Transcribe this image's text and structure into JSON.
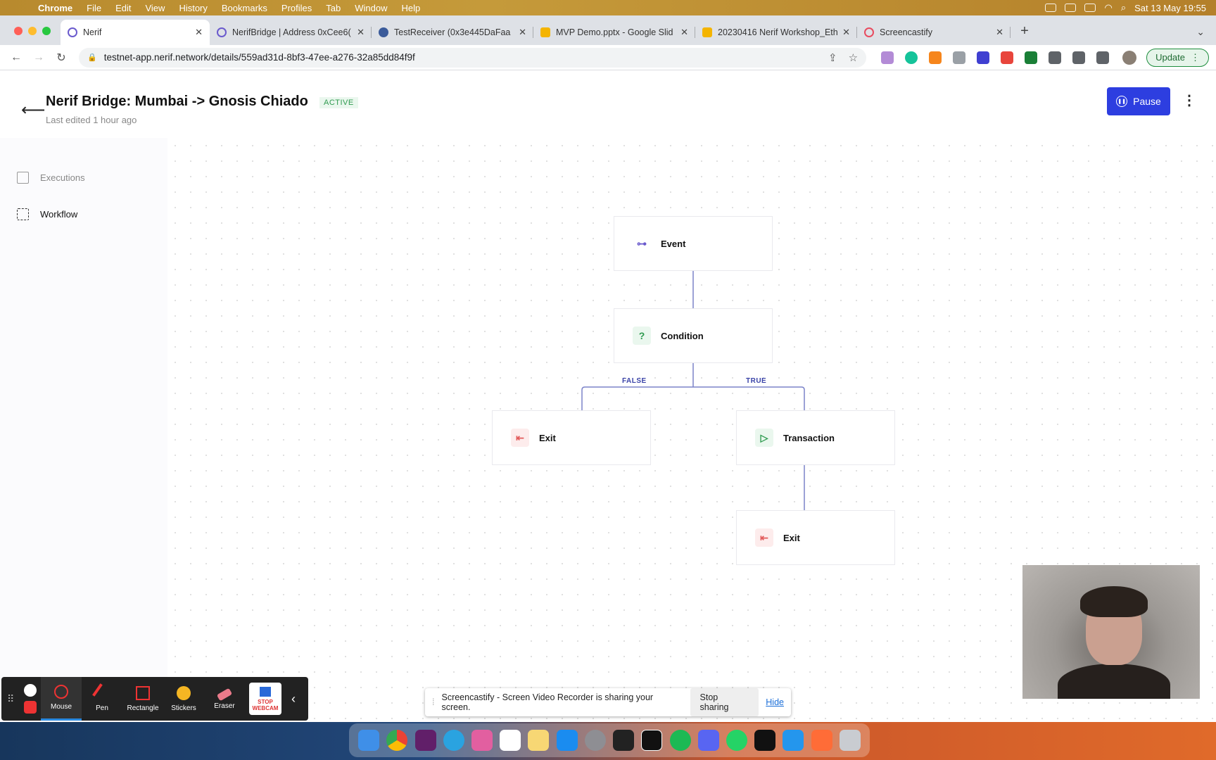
{
  "menubar": {
    "app": "Chrome",
    "items": [
      "File",
      "Edit",
      "View",
      "History",
      "Bookmarks",
      "Profiles",
      "Tab",
      "Window",
      "Help"
    ],
    "clock": "Sat 13 May  19:55"
  },
  "tabs": [
    {
      "title": "Nerif",
      "color": "#6a5acd"
    },
    {
      "title": "NerifBridge | Address 0xCee6(",
      "color": "#6a5acd"
    },
    {
      "title": "TestReceiver (0x3e445DaFaa",
      "color": "#3b5b9a"
    },
    {
      "title": "MVP Demo.pptx - Google Slid",
      "color": "#f4b400"
    },
    {
      "title": "20230416 Nerif Workshop_Eth",
      "color": "#f4b400"
    },
    {
      "title": "Screencastify",
      "color": "#e84b5f"
    }
  ],
  "toolbar": {
    "url": "testnet-app.nerif.network/details/559ad31d-8bf3-47ee-a276-32a85dd84f9f",
    "update_label": "Update"
  },
  "header": {
    "title": "Nerif Bridge: Mumbai -> Gnosis Chiado",
    "status": "ACTIVE",
    "subtitle": "Last edited 1 hour ago",
    "pause_label": "Pause"
  },
  "sidebar": {
    "items": [
      {
        "label": "Executions"
      },
      {
        "label": "Workflow"
      }
    ]
  },
  "workflow": {
    "nodes": [
      {
        "label": "Event",
        "icon": "link-icon",
        "color": "#6a5acd"
      },
      {
        "label": "Condition",
        "icon": "question-icon",
        "color": "#2e9a4f"
      },
      {
        "label": "Exit",
        "icon": "exit-icon",
        "color": "#e25b5b"
      },
      {
        "label": "Transaction",
        "icon": "play-icon",
        "color": "#2e9a4f"
      },
      {
        "label": "Exit",
        "icon": "exit-icon",
        "color": "#e25b5b"
      }
    ],
    "edges": {
      "false_label": "FALSE",
      "true_label": "TRUE"
    },
    "edge_color": "#7b83c9"
  },
  "screencastify": {
    "tools": [
      "Mouse",
      "Pen",
      "Rectangle",
      "Stickers",
      "Eraser"
    ],
    "stop_webcam": "STOP WEBCAM",
    "share_message": "Screencastify - Screen Video Recorder is sharing your screen.",
    "stop_sharing": "Stop sharing",
    "hide": "Hide"
  },
  "accent": "#2d3ee0"
}
